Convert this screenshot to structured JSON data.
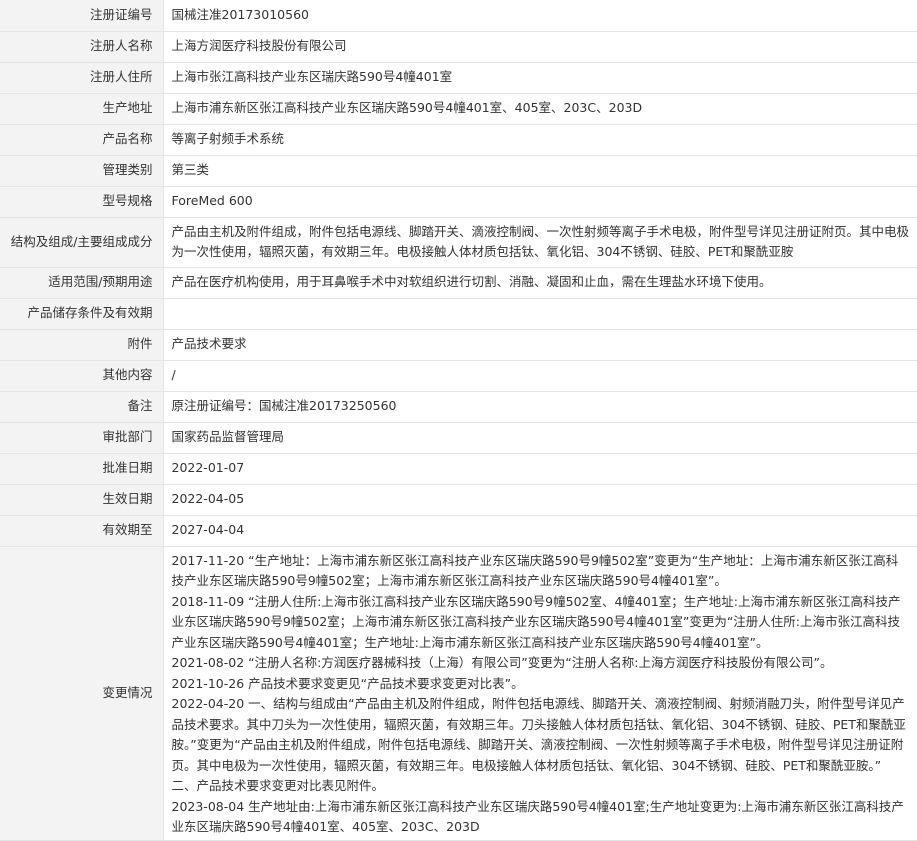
{
  "rows": [
    {
      "label": "注册证编号",
      "value": "国械注准20173010560"
    },
    {
      "label": "注册人名称",
      "value": "上海方润医疗科技股份有限公司"
    },
    {
      "label": "注册人住所",
      "value": "上海市张江高科技产业东区瑞庆路590号4幢401室"
    },
    {
      "label": "生产地址",
      "value": "上海市浦东新区张江高科技产业东区瑞庆路590号4幢401室、405室、203C、203D"
    },
    {
      "label": "产品名称",
      "value": "等离子射频手术系统"
    },
    {
      "label": "管理类别",
      "value": "第三类"
    },
    {
      "label": "型号规格",
      "value": "ForeMed 600"
    },
    {
      "label": "结构及组成/主要组成成分",
      "value": "产品由主机及附件组成，附件包括电源线、脚踏开关、滴液控制阀、一次性射频等离子手术电极，附件型号详见注册证附页。其中电极为一次性使用，辐照灭菌，有效期三年。电极接触人体材质包括钛、氧化铝、304不锈钢、硅胶、PET和聚酰亚胺"
    },
    {
      "label": "适用范围/预期用途",
      "value": "产品在医疗机构使用，用于耳鼻喉手术中对软组织进行切割、消融、凝固和止血，需在生理盐水环境下使用。"
    },
    {
      "label": "产品储存条件及有效期",
      "value": ""
    },
    {
      "label": "附件",
      "value": "产品技术要求"
    },
    {
      "label": "其他内容",
      "value": "/"
    },
    {
      "label": "备注",
      "value": "原注册证编号：国械注准20173250560"
    },
    {
      "label": "审批部门",
      "value": "国家药品监督管理局"
    },
    {
      "label": "批准日期",
      "value": "2022-01-07"
    },
    {
      "label": "生效日期",
      "value": "2022-04-05"
    },
    {
      "label": "有效期至",
      "value": "2027-04-04"
    }
  ],
  "changes": {
    "label": "变更情况",
    "entries": [
      "2017-11-20 “生产地址：上海市浦东新区张江高科技产业东区瑞庆路590号9幢502室”变更为“生产地址：上海市浦东新区张江高科技产业东区瑞庆路590号9幢502室；上海市浦东新区张江高科技产业东区瑞庆路590号4幢401室”。",
      "2018-11-09 “注册人住所:上海市张江高科技产业东区瑞庆路590号9幢502室、4幢401室；生产地址:上海市浦东新区张江高科技产业东区瑞庆路590号9幢502室；上海市浦东新区张江高科技产业东区瑞庆路590号4幢401室”变更为“注册人住所:上海市张江高科技产业东区瑞庆路590号4幢401室；生产地址:上海市浦东新区张江高科技产业东区瑞庆路590号4幢401室”。",
      "2021-08-02 “注册人名称:方润医疗器械科技（上海）有限公司”变更为“注册人名称:上海方润医疗科技股份有限公司”。",
      "2021-10-26 产品技术要求变更见“产品技术要求变更对比表”。",
      "2022-04-20 一、结构与组成由“产品由主机及附件组成，附件包括电源线、脚踏开关、滴液控制阀、射频消融刀头，附件型号详见产品技术要求。其中刀头为一次性使用，辐照灭菌，有效期三年。刀头接触人体材质包括钛、氧化铝、304不锈钢、硅胶、PET和聚酰亚胺。”变更为“产品由主机及附件组成，附件包括电源线、脚踏开关、滴液控制阀、一次性射频等离子手术电极，附件型号详见注册证附页。其中电极为一次性使用，辐照灭菌，有效期三年。电极接触人体材质包括钛、氧化铝、304不锈钢、硅胶、PET和聚酰亚胺。”",
      "二、产品技术要求变更对比表见附件。",
      "2023-08-04 生产地址由:上海市浦东新区张江高科技产业东区瑞庆路590号4幢401室;生产地址变更为:上海市浦东新区张江高科技产业东区瑞庆路590号4幢401室、405室、203C、203D"
    ]
  }
}
